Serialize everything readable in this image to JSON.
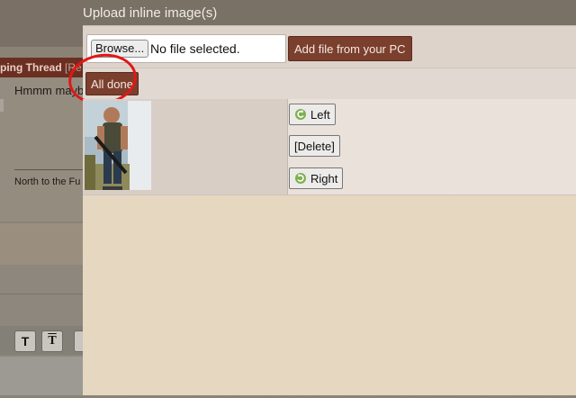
{
  "background_page": {
    "thread_bar_text": "ping Thread",
    "thread_bar_dim": "[Re",
    "post_text": "Hmmm mayb",
    "signature_text": "North to the Fu",
    "toolbar_buttons": [
      "T",
      "T"
    ]
  },
  "dialog": {
    "title": "Upload inline image(s)",
    "upload": {
      "browse_label": "Browse...",
      "file_status": "No file selected.",
      "add_file_label": "Add file from your PC"
    },
    "done_label": "All done",
    "image_actions": {
      "left_label": "Left",
      "delete_label": "[Delete]",
      "right_label": "Right"
    },
    "icons": {
      "left": "rotate-left-icon",
      "right": "rotate-right-icon"
    }
  },
  "colors": {
    "accent_button": "#7b3f2d",
    "annotation_circle": "#e01818",
    "title_bar": "#7a7166",
    "dialog_background": "#e6d8c0"
  }
}
